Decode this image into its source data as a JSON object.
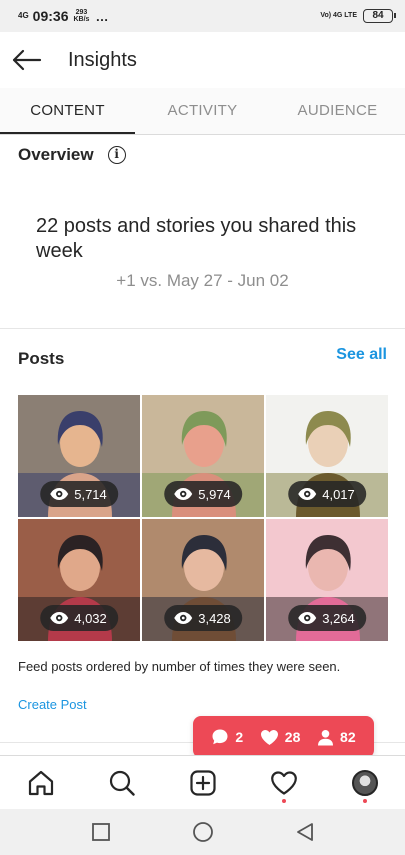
{
  "status_bar": {
    "signal": "4G",
    "time": "09:36",
    "speed_value": "293",
    "speed_unit": "KB/s",
    "more": "…",
    "network": "Vo) 4G LTE",
    "battery": "84"
  },
  "header": {
    "title": "Insights"
  },
  "tabs": [
    {
      "label": "CONTENT",
      "active": true
    },
    {
      "label": "ACTIVITY",
      "active": false
    },
    {
      "label": "AUDIENCE",
      "active": false
    }
  ],
  "overview": {
    "label": "Overview",
    "info_icon": "i",
    "summary": "22 posts and stories you shared this week",
    "comparison": "+1 vs. May 27 - Jun 02"
  },
  "posts": {
    "label": "Posts",
    "see_all": "See all",
    "items": [
      {
        "views": "5,714",
        "palette": [
          "#8b7f74",
          "#3a3f6b",
          "#e6b58f",
          "#d9a48a"
        ]
      },
      {
        "views": "5,974",
        "palette": [
          "#c9b79a",
          "#7e9a5a",
          "#e8a08c",
          "#d98f7c"
        ]
      },
      {
        "views": "4,017",
        "palette": [
          "#f2f2ef",
          "#8d8a4e",
          "#ead0b7",
          "#6b5a2d"
        ]
      },
      {
        "views": "4,032",
        "palette": [
          "#9a5e48",
          "#2b2224",
          "#e0a88a",
          "#b43a4a"
        ]
      },
      {
        "views": "3,428",
        "palette": [
          "#b08a6d",
          "#2c2e3a",
          "#e6b9a0",
          "#6f4d36"
        ]
      },
      {
        "views": "3,264",
        "palette": [
          "#f3c8cf",
          "#3e2f33",
          "#eab7b0",
          "#e26b98"
        ]
      }
    ],
    "note": "Feed posts ordered by number of times they were seen.",
    "create": "Create Post"
  },
  "activity_popup": {
    "comments": "2",
    "likes": "28",
    "followers": "82",
    "color": "#ed4956"
  },
  "bottom_nav": [
    "home-icon",
    "search-icon",
    "new-post-icon",
    "activity-heart-icon",
    "profile-avatar"
  ],
  "accent_color": "#1b95e0"
}
